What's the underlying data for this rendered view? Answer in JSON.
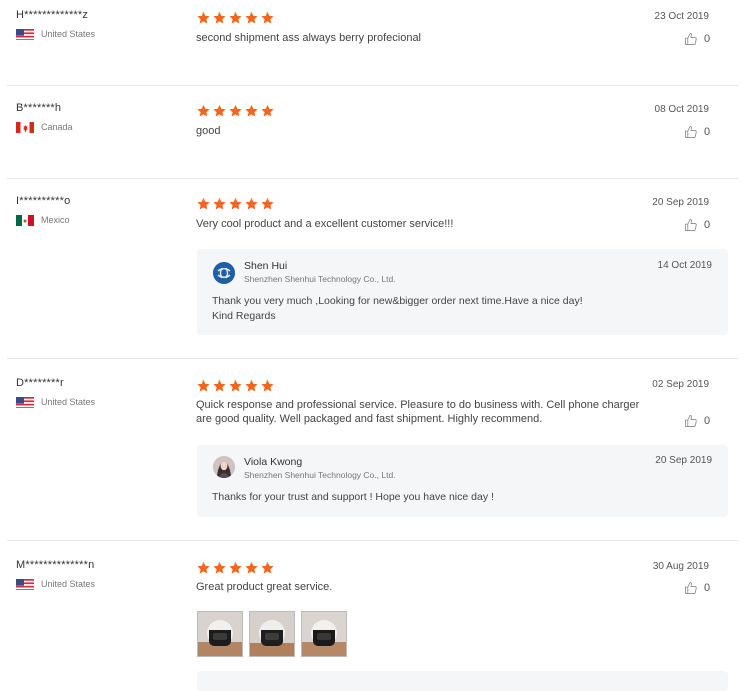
{
  "reviews": [
    {
      "user": "H*************z",
      "country": "United States",
      "flag": "us-flag",
      "rating": 5,
      "text": "second shipment ass always berry profecional",
      "date": "23 Oct 2019",
      "likes": "0"
    },
    {
      "user": "B*******h",
      "country": "Canada",
      "flag": "ca-flag",
      "rating": 5,
      "text": "good",
      "date": "08 Oct 2019",
      "likes": "0"
    },
    {
      "user": "I**********o",
      "country": "Mexico",
      "flag": "mx-flag",
      "rating": 5,
      "text": "Very cool product and a excellent customer service!!!",
      "date": "20 Sep 2019",
      "likes": "0",
      "reply": {
        "name": "Shen Hui",
        "company": "Shenzhen Shenhui Technology Co., Ltd.",
        "date": "14 Oct 2019",
        "lines": [
          "Thank you very much ,Looking for new&bigger order next time.Have a nice day!",
          "Kind Regards"
        ]
      }
    },
    {
      "user": "D********r",
      "country": "United States",
      "flag": "us-flag",
      "rating": 5,
      "text_lines": [
        "Quick response and professional service. Pleasure to do business with. Cell phone charger",
        "are good quality. Well packaged and fast shipment. Highly recommend."
      ],
      "date": "02 Sep 2019",
      "likes": "0",
      "reply": {
        "name": "Viola Kwong",
        "company": "Shenzhen Shenhui Technology Co., Ltd.",
        "date": "20 Sep 2019",
        "lines": [
          "Thanks for your trust and support  ! Hope you have nice day !"
        ]
      }
    },
    {
      "user": "M**************n",
      "country": "United States",
      "flag": "us-flag",
      "rating": 5,
      "text": "Great product great service.",
      "date": "30 Aug 2019",
      "likes": "0",
      "photos": 3
    }
  ],
  "colors": {
    "star": "#f4661b",
    "divider": "#e6e6e6",
    "reply_bg": "#f5f6f8"
  },
  "icons": {
    "star": "star-icon",
    "like": "thumbs-up-icon"
  }
}
